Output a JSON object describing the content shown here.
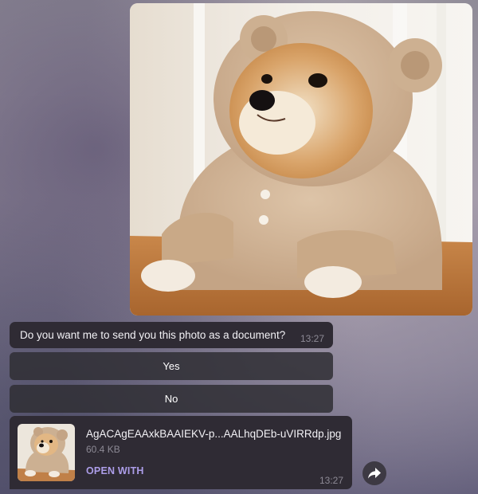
{
  "messages": {
    "photo": {
      "icon": "photo-dog-in-bear-costume"
    },
    "prompt": {
      "text": "Do you want me to send you this photo as a document?",
      "time": "13:27"
    },
    "buttons": {
      "yes_label": "Yes",
      "no_label": "No"
    },
    "document": {
      "thumbnail_icon": "photo-thumbnail",
      "filename": "AgACAgEAAxkBAAIEKV-p...AALhqDEb-uVIRRdp.jpg",
      "size": "60.4 KB",
      "open_label": "OPEN WITH",
      "time": "13:27"
    },
    "share_icon": "share-arrow-icon"
  },
  "colors": {
    "bubble_bg": "#2f2b34",
    "button_bg": "#302e34",
    "accent": "#ac9de8",
    "meta_text": "#8d8a95"
  }
}
